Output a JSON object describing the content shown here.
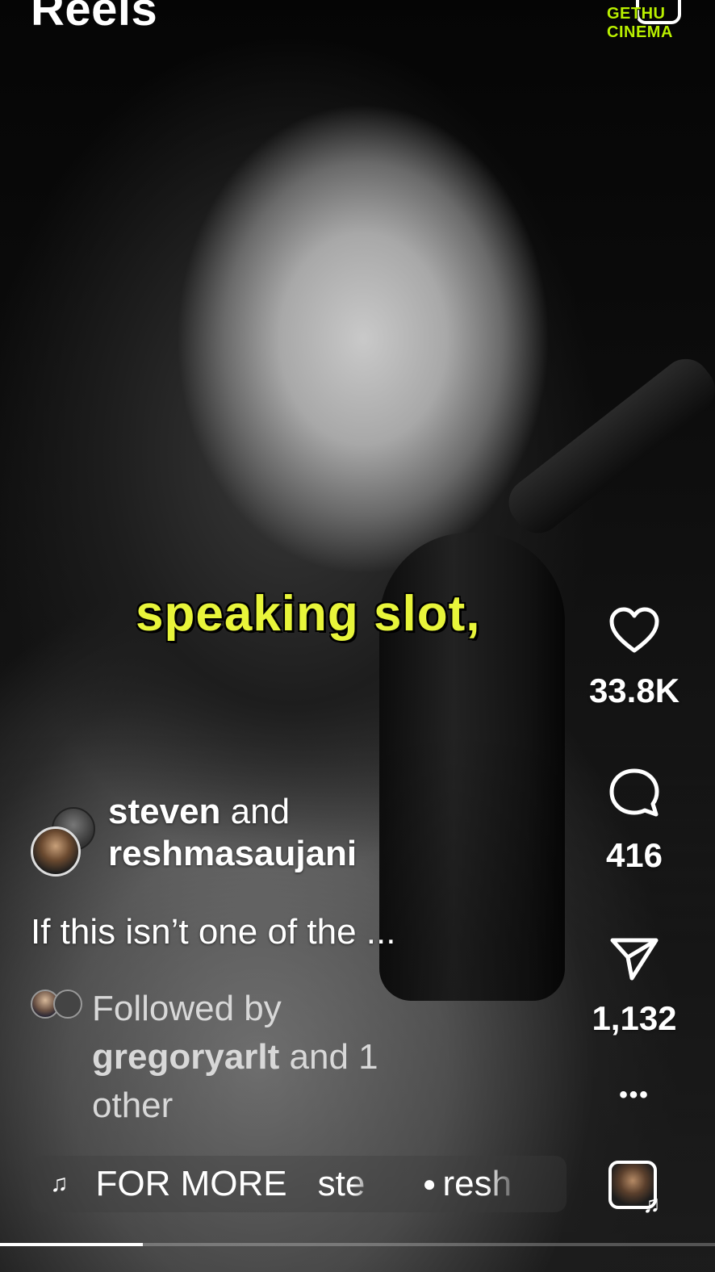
{
  "header": {
    "title": "Reels",
    "camera_icon": "camera-icon",
    "watermark": "GETHU CINEMA"
  },
  "video": {
    "caption": "speaking slot,"
  },
  "actions": {
    "like_icon": "heart-icon",
    "like_count": "33.8K",
    "comment_icon": "comment-icon",
    "comment_count": "416",
    "share_icon": "send-icon",
    "share_count": "1,132",
    "more_label": "•••"
  },
  "post": {
    "author_primary": "steven",
    "author_joiner": " and",
    "author_secondary": "reshmasaujani",
    "description": "If this isn’t one of the ...",
    "followed_prefix": "Followed by",
    "followed_user": "gregoryarlt",
    "followed_suffix": " and 1 other"
  },
  "music": {
    "note_icon": "music-note-icon",
    "track_text": "FOR MORE",
    "track_text_2": "ste",
    "person_icon": "person-icon",
    "track_text_3": "resh"
  },
  "progress": {
    "fraction": 0.2
  },
  "colors": {
    "caption": "#e8f53a",
    "watermark": "#b9f000"
  }
}
